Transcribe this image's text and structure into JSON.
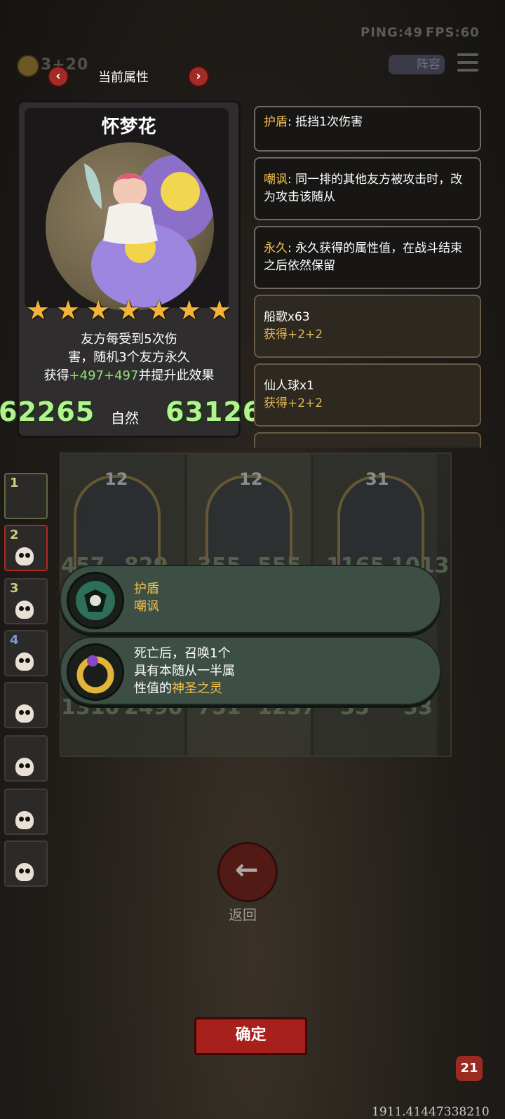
{
  "hud": {
    "ping": "PING:49",
    "fps": "FPS:60",
    "coins": "3+20",
    "lineup_label": "阵容"
  },
  "header": {
    "title": "当前属性",
    "prev": "‹",
    "next": "›"
  },
  "card": {
    "name": "怀梦花",
    "stars": 7,
    "desc_line1": "友方每受到5次伤",
    "desc_line2": "害，随机3个友方永久",
    "desc_pre": "获得",
    "plus1": "+497",
    "plus2": "+497",
    "desc_post": "并提升此效果",
    "attack": "62265",
    "element": "自然",
    "health": "63126"
  },
  "info": [
    {
      "keyword": "护盾",
      "text": ": 抵挡1次伤害"
    },
    {
      "keyword": "嘲讽",
      "text": ": 同一排的其他友方被攻击时，改为攻击该随从"
    },
    {
      "keyword": "永久",
      "text": ": 永久获得的属性值，在战斗结束之后依然保留"
    },
    {
      "title": "船歌x63",
      "sub": "获得+2+2"
    },
    {
      "title": "仙人球x1",
      "sub": "获得+2+2"
    }
  ],
  "board": {
    "levels": [
      "12",
      "12",
      "31"
    ],
    "stats_top": [
      "457",
      "829",
      "355",
      "555",
      "1165",
      "1013"
    ],
    "stats_bottom": [
      "1310",
      "2490",
      "751",
      "1237",
      "35",
      "33"
    ]
  },
  "sidebar": [
    "1",
    "2",
    "3",
    "4",
    "",
    "",
    "",
    ""
  ],
  "popups": [
    {
      "line1": "护盾",
      "line2": "嘲讽"
    },
    {
      "line1": "死亡后，召唤1个",
      "line2": "具有本随从一半属",
      "line3_pre": "性值的",
      "line3_kw": "神圣之灵"
    }
  ],
  "back_label": "返回",
  "confirm_label": "确定",
  "hp_badge": "21",
  "coords": "1911.41447338210",
  "colors": {
    "keyword": "#f3c14c",
    "plus_green": "#8fe07a",
    "stat_green": "#b4f28d",
    "confirm_red": "#a8201c"
  }
}
